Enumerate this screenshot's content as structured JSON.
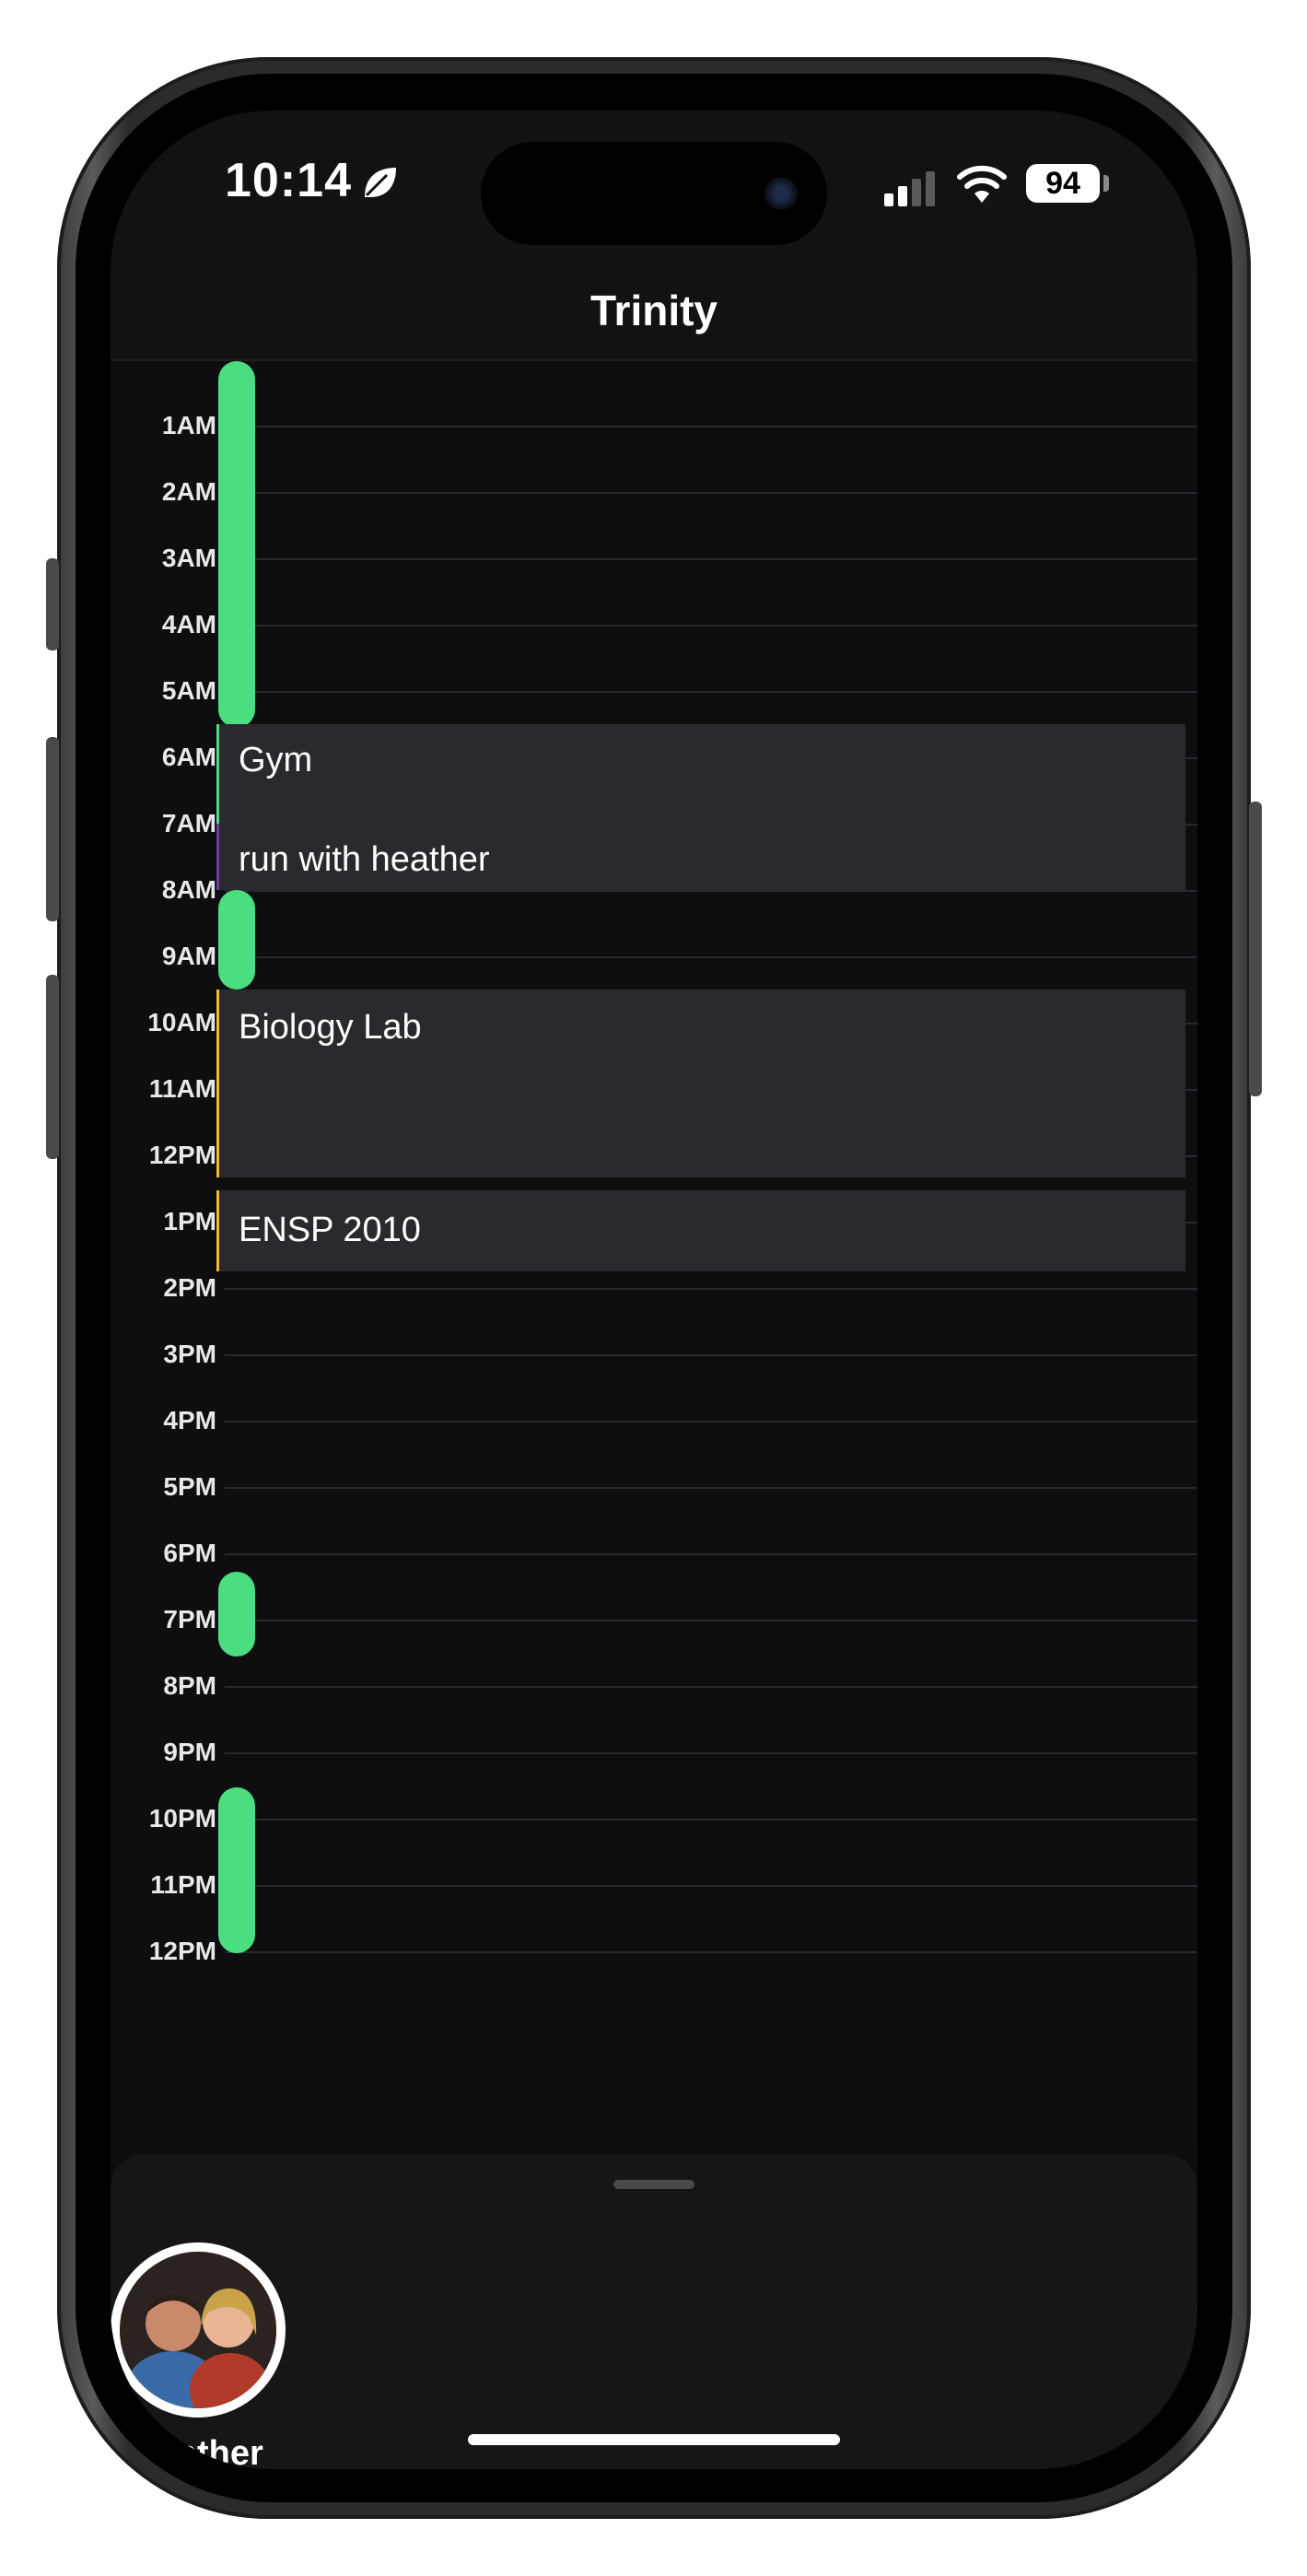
{
  "status_bar": {
    "time": "10:14",
    "battery": "94",
    "icons": [
      "leaf-icon",
      "signal-icon",
      "wifi-icon",
      "battery-icon"
    ]
  },
  "header": {
    "title": "Trinity"
  },
  "timeline": {
    "hours": [
      "1AM",
      "2AM",
      "3AM",
      "4AM",
      "5AM",
      "6AM",
      "7AM",
      "8AM",
      "9AM",
      "10AM",
      "11AM",
      "12PM",
      "1PM",
      "2PM",
      "3PM",
      "4PM",
      "5PM",
      "6PM",
      "7PM",
      "8PM",
      "9PM",
      "10PM",
      "11PM",
      "12PM"
    ],
    "events": [
      {
        "title": "Gym",
        "accent": "#4ade80"
      },
      {
        "title": "run with heather",
        "accent": "#6b3fa0"
      },
      {
        "title": "Biology Lab",
        "accent": "#f5b82e"
      },
      {
        "title": "ENSP 2010",
        "accent": "#f5b82e"
      }
    ],
    "free_color": "#4ade80"
  },
  "sheet": {
    "friends": [
      {
        "name": "Heather",
        "avatar": "avatar-photo"
      }
    ]
  }
}
